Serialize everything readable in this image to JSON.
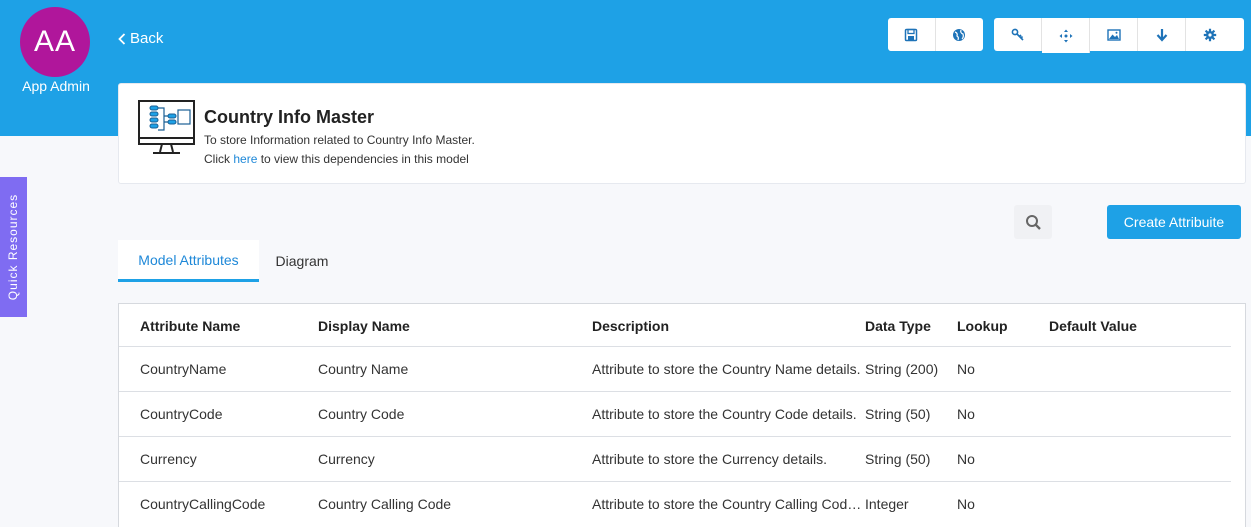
{
  "header": {
    "avatar_initials": "AA",
    "user_name": "App Admin",
    "back_label": "Back",
    "toolbar_group1": [
      "save-icon",
      "globe-icon"
    ],
    "toolbar_group2": [
      "key-icon",
      "move-icon",
      "image-icon",
      "arrow-down-icon",
      "gear-icon"
    ]
  },
  "model": {
    "title": "Country Info Master",
    "description": "To store Information related to Country Info Master.",
    "link_prefix": "Click ",
    "link_text": "here",
    "link_suffix": " to view this dependencies in this model"
  },
  "sidebar": {
    "quick_resources_label": "Quick Resources"
  },
  "actions": {
    "create_label": "Create Attribuite"
  },
  "tabs": [
    {
      "label": "Model Attributes"
    },
    {
      "label": "Diagram"
    }
  ],
  "table": {
    "columns": [
      "Attribute Name",
      "Display Name",
      "Description",
      "Data Type",
      "Lookup",
      "Default Value"
    ],
    "rows": [
      {
        "attribute_name": "CountryName",
        "display_name": "Country Name",
        "description": "Attribute to store the Country Name details.",
        "data_type": "String (200)",
        "lookup": "No",
        "default_value": ""
      },
      {
        "attribute_name": "CountryCode",
        "display_name": "Country Code",
        "description": "Attribute to store the Country Code details.",
        "data_type": "String (50)",
        "lookup": "No",
        "default_value": ""
      },
      {
        "attribute_name": "Currency",
        "display_name": "Currency",
        "description": "Attribute to store the Currency details.",
        "data_type": "String (50)",
        "lookup": "No",
        "default_value": ""
      },
      {
        "attribute_name": "CountryCallingCode",
        "display_name": "Country Calling Code",
        "description": "Attribute to store the Country Calling Code details.",
        "data_type": "Integer",
        "lookup": "No",
        "default_value": ""
      }
    ]
  },
  "colors": {
    "header_bg": "#1ea1e6",
    "avatar_bg": "#b0169b",
    "quick_resources_bg": "#7f6cf2",
    "link": "#1e88d8"
  }
}
